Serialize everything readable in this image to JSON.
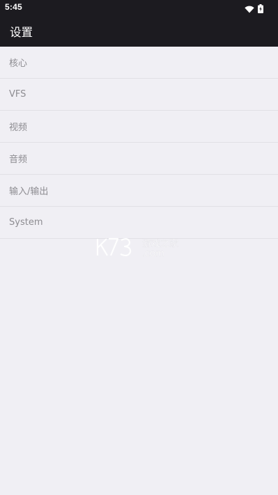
{
  "status_bar": {
    "time": "5:45",
    "icons": [
      "wifi-icon",
      "battery-charging-icon"
    ]
  },
  "app_bar": {
    "title": "设置"
  },
  "settings": {
    "items": [
      {
        "label": "核心"
      },
      {
        "label": "VFS"
      },
      {
        "label": "视频"
      },
      {
        "label": "音频"
      },
      {
        "label": "输入/输出"
      },
      {
        "label": "System"
      }
    ]
  },
  "watermark": {
    "text": "K73 游戏之家 .com"
  },
  "colors": {
    "app_bar": "#1c1b20",
    "background": "#f0eff4",
    "item_text": "#8d8c91",
    "divider": "#e1e0e5"
  }
}
